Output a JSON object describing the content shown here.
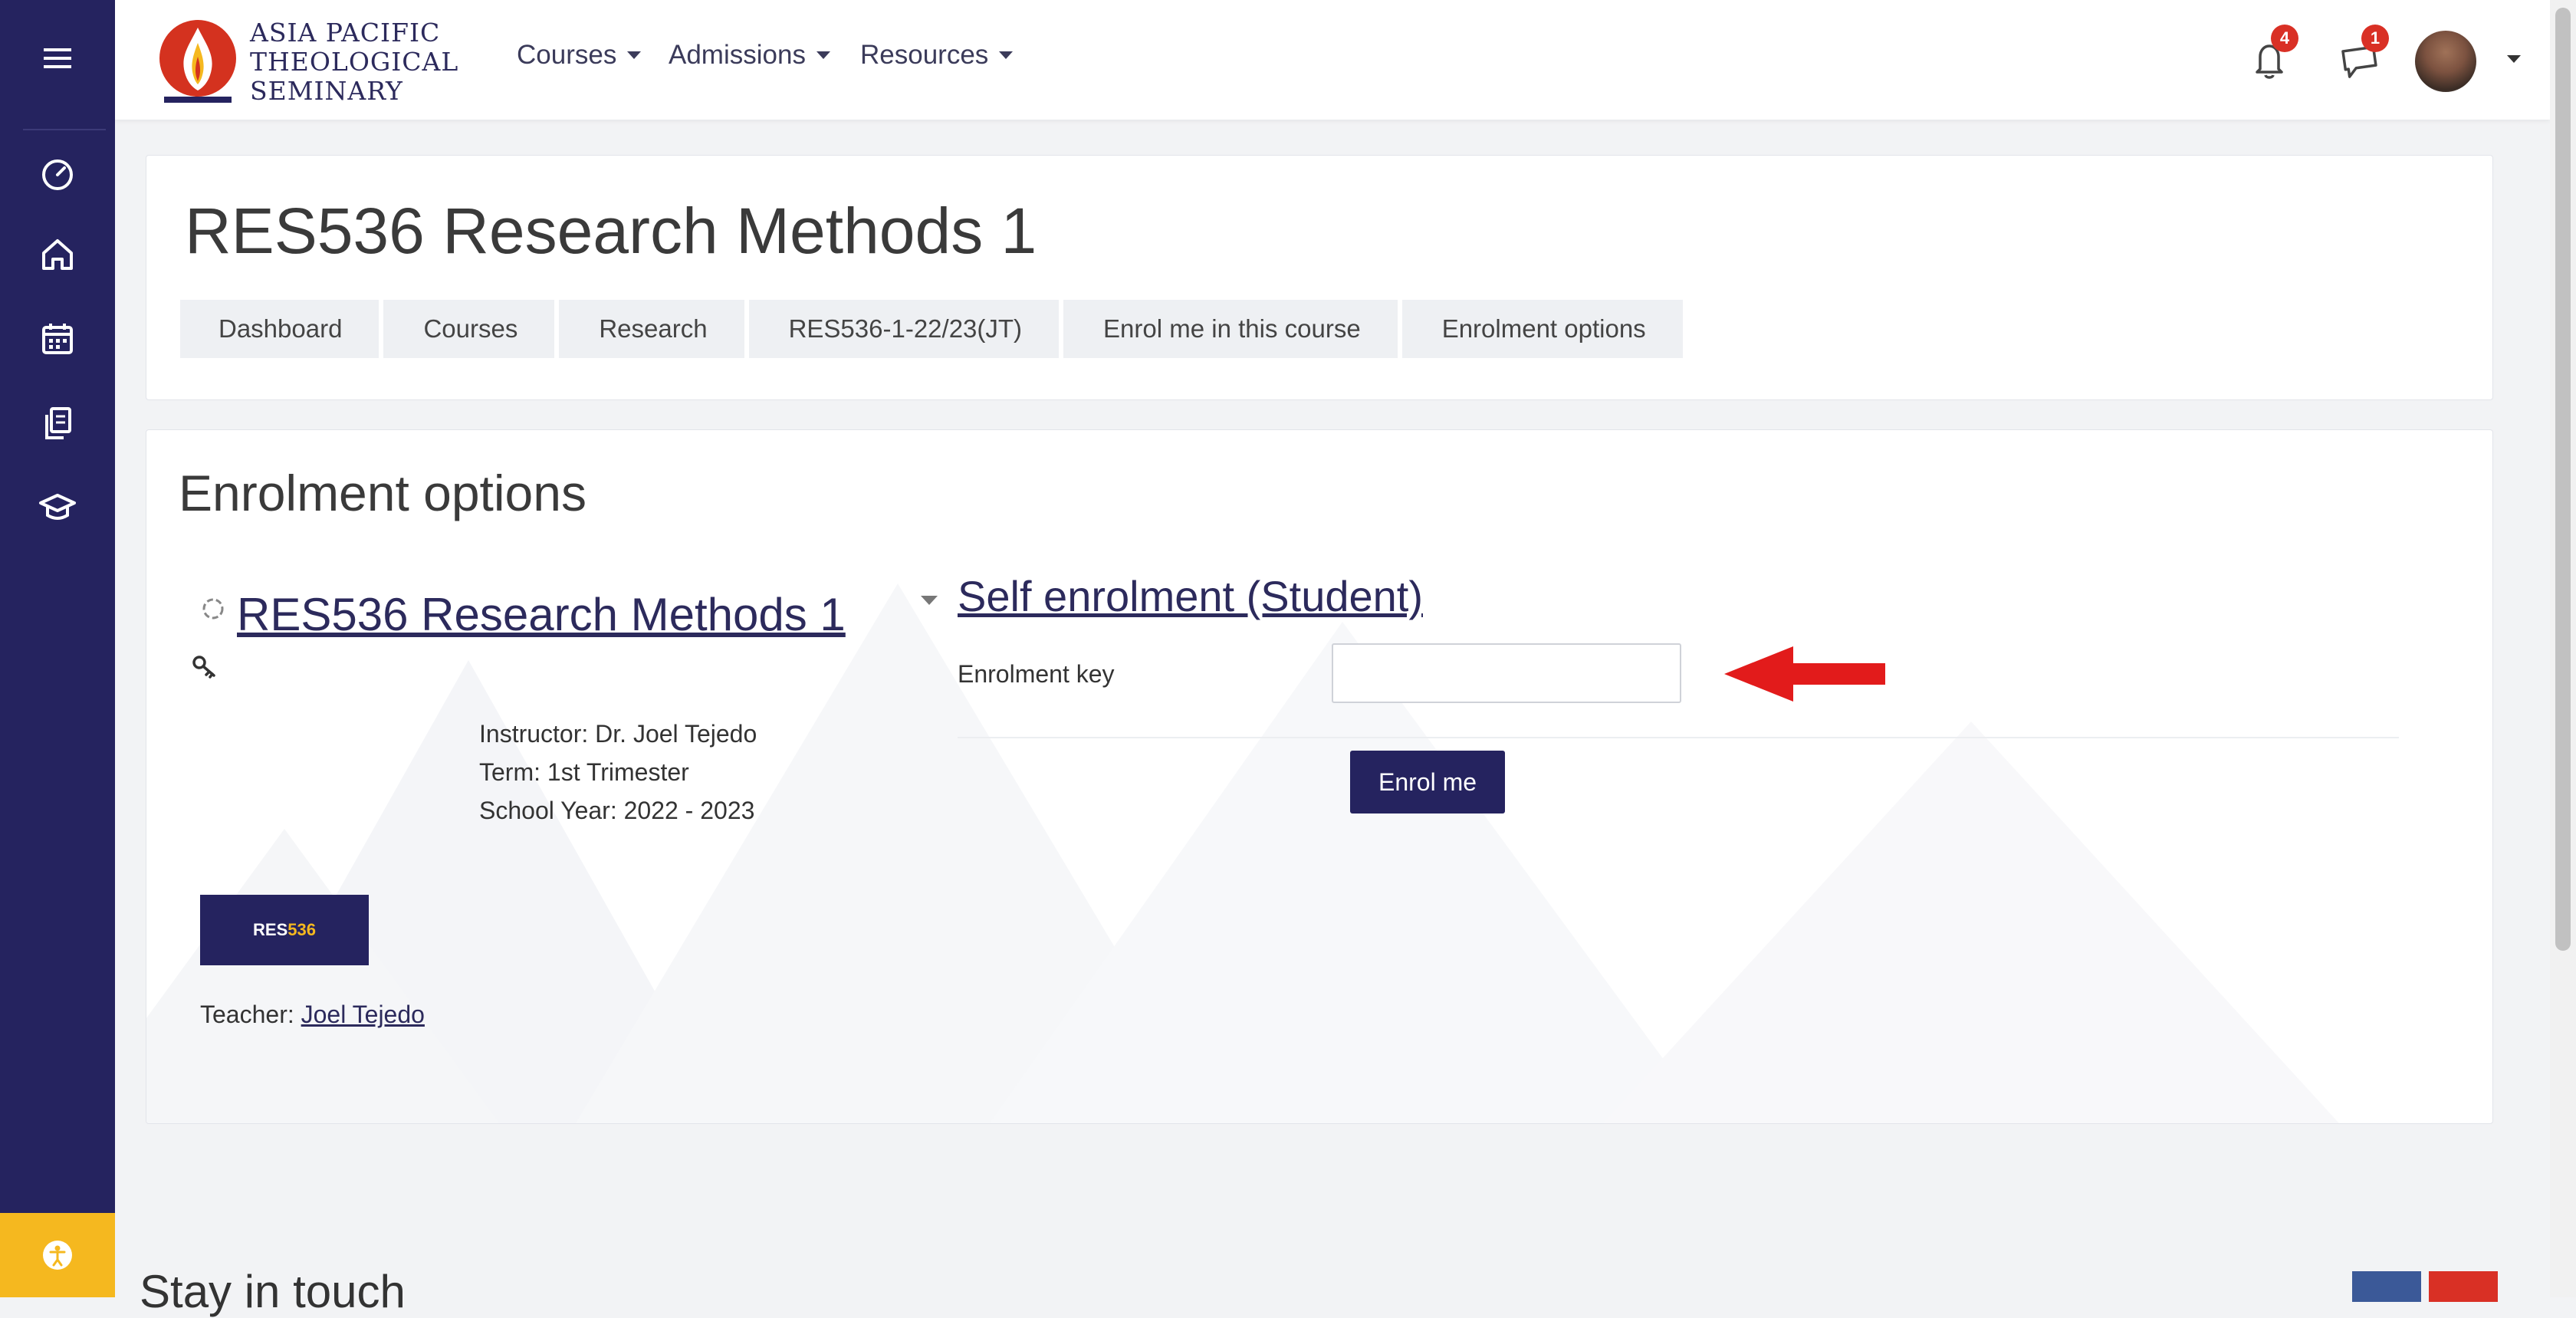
{
  "brand": {
    "logo_lines": [
      "ASIA PACIFIC",
      "THEOLOGICAL",
      "SEMINARY"
    ]
  },
  "nav": {
    "menus": [
      "Courses",
      "Admissions",
      "Resources"
    ]
  },
  "notifications": {
    "count": "4"
  },
  "messages": {
    "count": "1"
  },
  "sidebar_icons": [
    "menu-icon",
    "dashboard-icon",
    "home-icon",
    "calendar-icon",
    "content-bank-icon",
    "courses-icon",
    "accessibility-icon"
  ],
  "course": {
    "title": "RES536 Research Methods 1"
  },
  "breadcrumb": [
    "Dashboard",
    "Courses",
    "Research",
    "RES536-1-22/23(JT)",
    "Enrol me in this course",
    "Enrolment options"
  ],
  "page": {
    "heading": "Enrolment options"
  },
  "coursebox": {
    "title": "RES536 Research Methods 1",
    "summary": [
      "Instructor: Dr. Joel Tejedo",
      "Term: 1st Trimester",
      "School Year: 2022 - 2023"
    ],
    "image_label_a": "RES",
    "image_label_b": "536",
    "teacher_label": "Teacher: ",
    "teacher_name": "Joel Tejedo"
  },
  "self_enrol": {
    "legend": "Self enrolment (Student)",
    "key_label": "Enrolment key",
    "key_value": "",
    "button": "Enrol me"
  },
  "footer": {
    "heading": "Stay in touch"
  },
  "colors": {
    "primary": "#25235f",
    "accent": "#f5b81f",
    "badge": "#d93025",
    "arrow": "#e21b1b"
  }
}
